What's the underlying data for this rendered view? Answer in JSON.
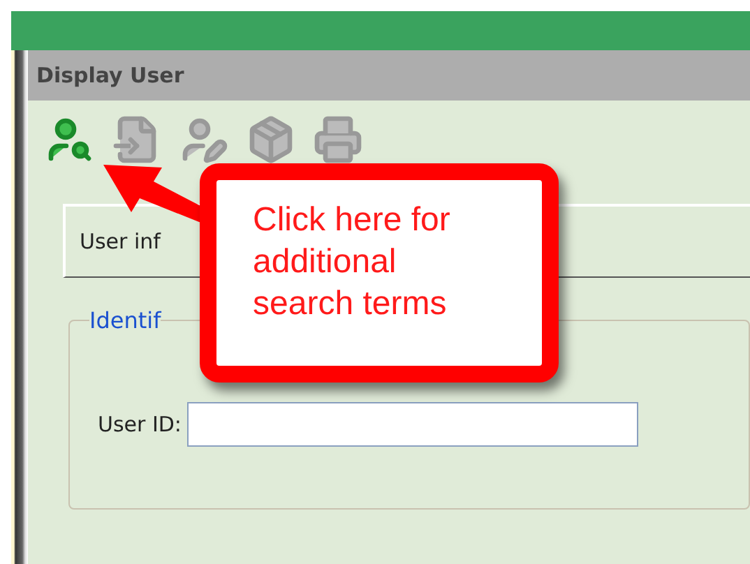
{
  "window": {
    "title": "Display User"
  },
  "toolbar": [
    {
      "kind": "user-search",
      "disabled": false
    },
    {
      "kind": "document-hand",
      "disabled": true
    },
    {
      "kind": "user-edit",
      "disabled": true
    },
    {
      "kind": "package",
      "disabled": true
    },
    {
      "kind": "printer",
      "disabled": true
    }
  ],
  "tab": {
    "label": "User inf"
  },
  "fieldset": {
    "legend": "Identif",
    "fields": [
      {
        "label": "User ID:"
      }
    ]
  },
  "callout": {
    "text": "Click here for additional search terms"
  }
}
